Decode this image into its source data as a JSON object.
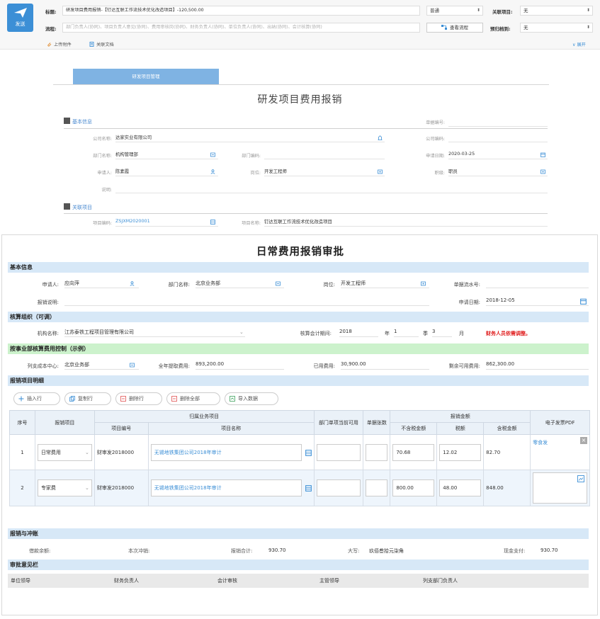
{
  "toolbar": {
    "send_label": "发送",
    "subject_label": "标题:",
    "subject_value": "研发项目费用报销-【钉达互联工作流技术优化改造项目】-120,500.00",
    "flow_label": "流程:",
    "flow_placeholder": "部门负责人(协同)、项目负责人意见(协同)、费用审核岗(协同)、财务负责人(协同)、单位负责人(协同)、出纳(协同)、会计核算(协同)",
    "priority_value": "普通",
    "view_flow_label": "查看流程",
    "related_project_label": "关联项目:",
    "related_project_value": "无",
    "deadline_label": "预归档到:",
    "deadline_value": "无",
    "upload_label": "上传附件",
    "relate_doc_label": "关联文档",
    "expand_label": "展开"
  },
  "back_form": {
    "tab_label": "研发项目管理",
    "title": "研发项目费用报销",
    "basic_section": "基本信息",
    "related_section": "关联项目",
    "fields": {
      "bill_no_label": "单据编号:",
      "company_label": "公司名称:",
      "company_value": "达家实业有限公司",
      "company_code_label": "公司编码:",
      "dept_label": "部门名称:",
      "dept_value": "机构管理部",
      "dept_code_label": "部门编码:",
      "apply_date_label": "申请日期:",
      "apply_date_value": "2020-03-25",
      "applicant_label": "申请人:",
      "applicant_value": "陈素霞",
      "post_label": "岗位:",
      "post_value": "开发工程师",
      "rank_label": "职级:",
      "rank_value": "职员",
      "desc_label": "说明:",
      "project_code_label": "项目编码:",
      "project_code_value": "ZSJXM2020001",
      "project_name_label": "项目名称:",
      "project_name_value": "钉达互联工作流技术优化改造项目"
    }
  },
  "front_form": {
    "title": "日常费用报销审批",
    "sec_basic": "基本信息",
    "applicant_label": "申请人:",
    "applicant_value": "应向萍",
    "dept_label": "部门名称:",
    "dept_value": "北京业务部",
    "post_label": "岗位:",
    "post_value": "开发工程师",
    "serial_label": "单据流水号:",
    "reason_label": "报销说明:",
    "apply_date_label": "申请日期:",
    "apply_date_value": "2018-12-05",
    "sec_org": "核算组织（可调）",
    "org_label": "机构名称:",
    "org_value": "江苏泰铁工程项目管理有限公司",
    "period_label": "核算会计期间:",
    "period_year": "2018",
    "year_unit": "年",
    "period_q": "1",
    "q_unit": "季",
    "period_m": "3",
    "m_unit": "月",
    "period_note": "财务人员依需调整。",
    "sec_budget": "按事业部核算费用控制（示例）",
    "cost_center_label": "列支成本中心:",
    "cost_center_value": "北京业务部",
    "annual_label": "全年提取费用:",
    "annual_value": "893,200.00",
    "used_label": "已用费用:",
    "used_value": "30,900.00",
    "remain_label": "剩余可用费用:",
    "remain_value": "862,300.00",
    "sec_detail": "报销项目明细",
    "buttons": [
      "插入行",
      "复制行",
      "删除行",
      "删除全部",
      "导入数据"
    ],
    "table": {
      "h_seq": "序号",
      "h_item": "报销项目",
      "h_business": "归属业务项目",
      "h_code": "项目编号",
      "h_name": "项目名称",
      "h_dept_avail": "部门单项当前可用",
      "h_docs": "单据张数",
      "h_amount": "报销金额",
      "h_excl": "不含税金额",
      "h_tax": "税额",
      "h_incl": "含税金额",
      "h_pdf": "电子发票PDF",
      "rows": [
        {
          "seq": "1",
          "item": "日常费用",
          "code": "财审发2018000",
          "name": "无锡地铁集团公司2018年审计",
          "excl": "70.68",
          "tax": "12.02",
          "incl": "82.70",
          "pdf": "零食发"
        },
        {
          "seq": "2",
          "item": "专家费",
          "code": "财审发2018000",
          "name": "无锡地铁集团公司2018年审计",
          "excl": "800.00",
          "tax": "48.00",
          "incl": "848.00",
          "pdf": ""
        }
      ]
    },
    "sec_settle": "报销与冲账",
    "loan_label": "借款余额:",
    "offset_label": "本次冲销:",
    "total_label": "报销合计:",
    "total_value": "930.70",
    "upper_label": "大写:",
    "upper_value": "玖佰叁拾元柒角",
    "cash_label": "现金支付:",
    "cash_value": "930.70",
    "sec_approve": "审批意见栏",
    "approvers": [
      "单位领导",
      "财务负责人",
      "会计审核",
      "主管领导",
      "列支部门负责人"
    ]
  },
  "colors": {
    "accent": "#3c8fd6",
    "band": "#d7e8f7",
    "band_green": "#ccf2cc",
    "warning": "#e02020"
  }
}
